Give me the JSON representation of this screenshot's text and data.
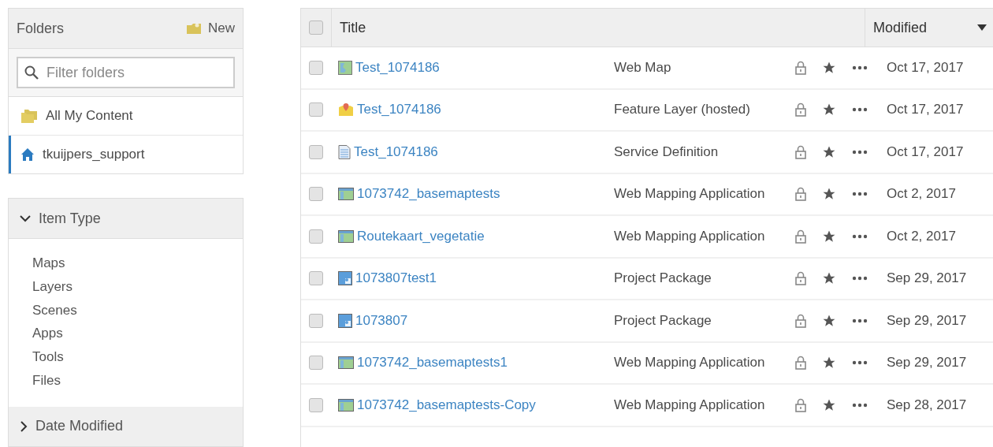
{
  "folders": {
    "title": "Folders",
    "new_button": "New",
    "filter": {
      "placeholder": "Filter folders"
    },
    "items": [
      {
        "label": "All My Content",
        "kind": "all",
        "selected": false
      },
      {
        "label": "tkuijpers_support",
        "kind": "home",
        "selected": true
      }
    ]
  },
  "filters": [
    {
      "title": "Item Type",
      "expanded": true,
      "options": [
        "Maps",
        "Layers",
        "Scenes",
        "Apps",
        "Tools",
        "Files"
      ]
    },
    {
      "title": "Date Modified",
      "expanded": false
    }
  ],
  "table": {
    "select_all": {
      "checked": false
    },
    "columns": [
      "Title",
      "Modified"
    ],
    "rows": [
      {
        "checked": false,
        "kind": "webmap",
        "title": "Test_1074186",
        "type": "Web Map",
        "modified": "Oct 17, 2017"
      },
      {
        "checked": false,
        "kind": "feature",
        "title": "Test_1074186",
        "type": "Feature Layer (hosted)",
        "modified": "Oct 17, 2017"
      },
      {
        "checked": false,
        "kind": "document",
        "title": "Test_1074186",
        "type": "Service Definition",
        "modified": "Oct 17, 2017"
      },
      {
        "checked": false,
        "kind": "app",
        "title": "1073742_basemaptests",
        "type": "Web Mapping Application",
        "modified": "Oct 2, 2017"
      },
      {
        "checked": false,
        "kind": "app",
        "title": "Routekaart_vegetatie",
        "type": "Web Mapping Application",
        "modified": "Oct 2, 2017"
      },
      {
        "checked": false,
        "kind": "package",
        "title": "1073807test1",
        "type": "Project Package",
        "modified": "Sep 29, 2017"
      },
      {
        "checked": false,
        "kind": "package",
        "title": "1073807",
        "type": "Project Package",
        "modified": "Sep 29, 2017"
      },
      {
        "checked": false,
        "kind": "app",
        "title": "1073742_basemaptests1",
        "type": "Web Mapping Application",
        "modified": "Sep 29, 2017"
      },
      {
        "checked": false,
        "kind": "app",
        "title": "1073742_basemaptests-Copy",
        "type": "Web Mapping Application",
        "modified": "Sep 28, 2017"
      }
    ]
  }
}
